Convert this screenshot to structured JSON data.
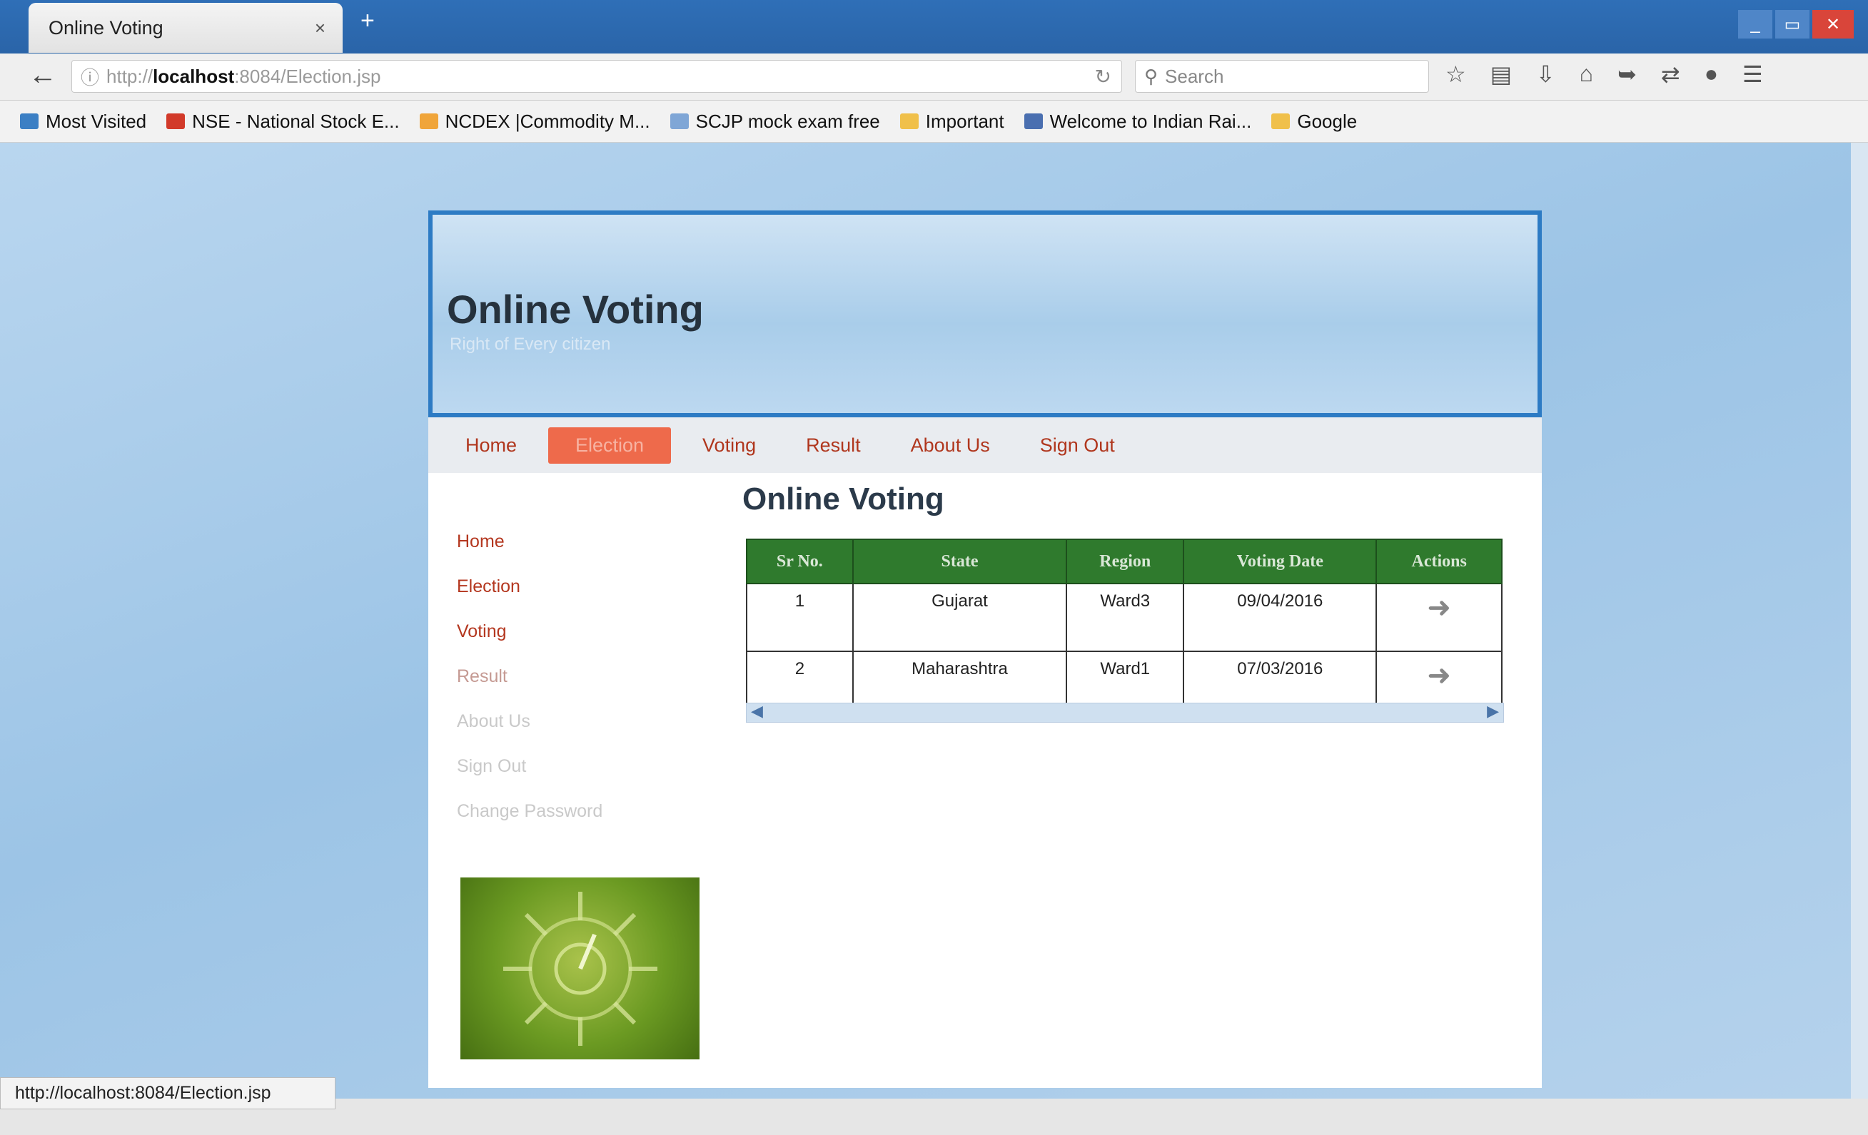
{
  "browser": {
    "tab_title": "Online Voting",
    "tab_close": "×",
    "new_tab": "+",
    "url_scheme": "http://",
    "url_host": "localhost",
    "url_path": ":8084/Election.jsp",
    "search_placeholder": "Search",
    "window_controls": [
      "_",
      "▭",
      "✕"
    ],
    "bookmarks": [
      {
        "label": "Most Visited",
        "color": "#3b7fc4"
      },
      {
        "label": "NSE - National Stock E...",
        "color": "#d23a2a"
      },
      {
        "label": "NCDEX |Commodity M...",
        "color": "#f0a53a"
      },
      {
        "label": "SCJP mock exam free",
        "color": "#7fa6d6"
      },
      {
        "label": "Important",
        "color": "#f0c04a"
      },
      {
        "label": "Welcome to Indian Rai...",
        "color": "#4a6fb0"
      },
      {
        "label": "Google",
        "color": "#f0c04a"
      }
    ],
    "status_url": "http://localhost:8084/Election.jsp"
  },
  "site": {
    "title": "Online Voting",
    "subtitle": "Right of Every citizen",
    "menu": [
      "Home",
      "Election",
      "Voting",
      "Result",
      "About Us",
      "Sign Out"
    ],
    "sidebar": [
      "Home",
      "Election",
      "Voting",
      "Result",
      "About Us",
      "Sign Out",
      "Change Password"
    ]
  },
  "content": {
    "heading": "Online Voting",
    "columns": [
      "Sr No.",
      "State",
      "Region",
      "Voting Date",
      "Actions"
    ],
    "rows": [
      {
        "sr": "1",
        "state": "Gujarat",
        "region": "Ward3",
        "date": "09/04/2016"
      },
      {
        "sr": "2",
        "state": "Maharashtra",
        "region": "Ward1",
        "date": "07/03/2016"
      }
    ]
  },
  "colors": {
    "accent_blue": "#2d7bc4",
    "menu_text": "#b0361d",
    "menu_active": "#ee6a4b",
    "table_header": "#2f7a2d"
  }
}
